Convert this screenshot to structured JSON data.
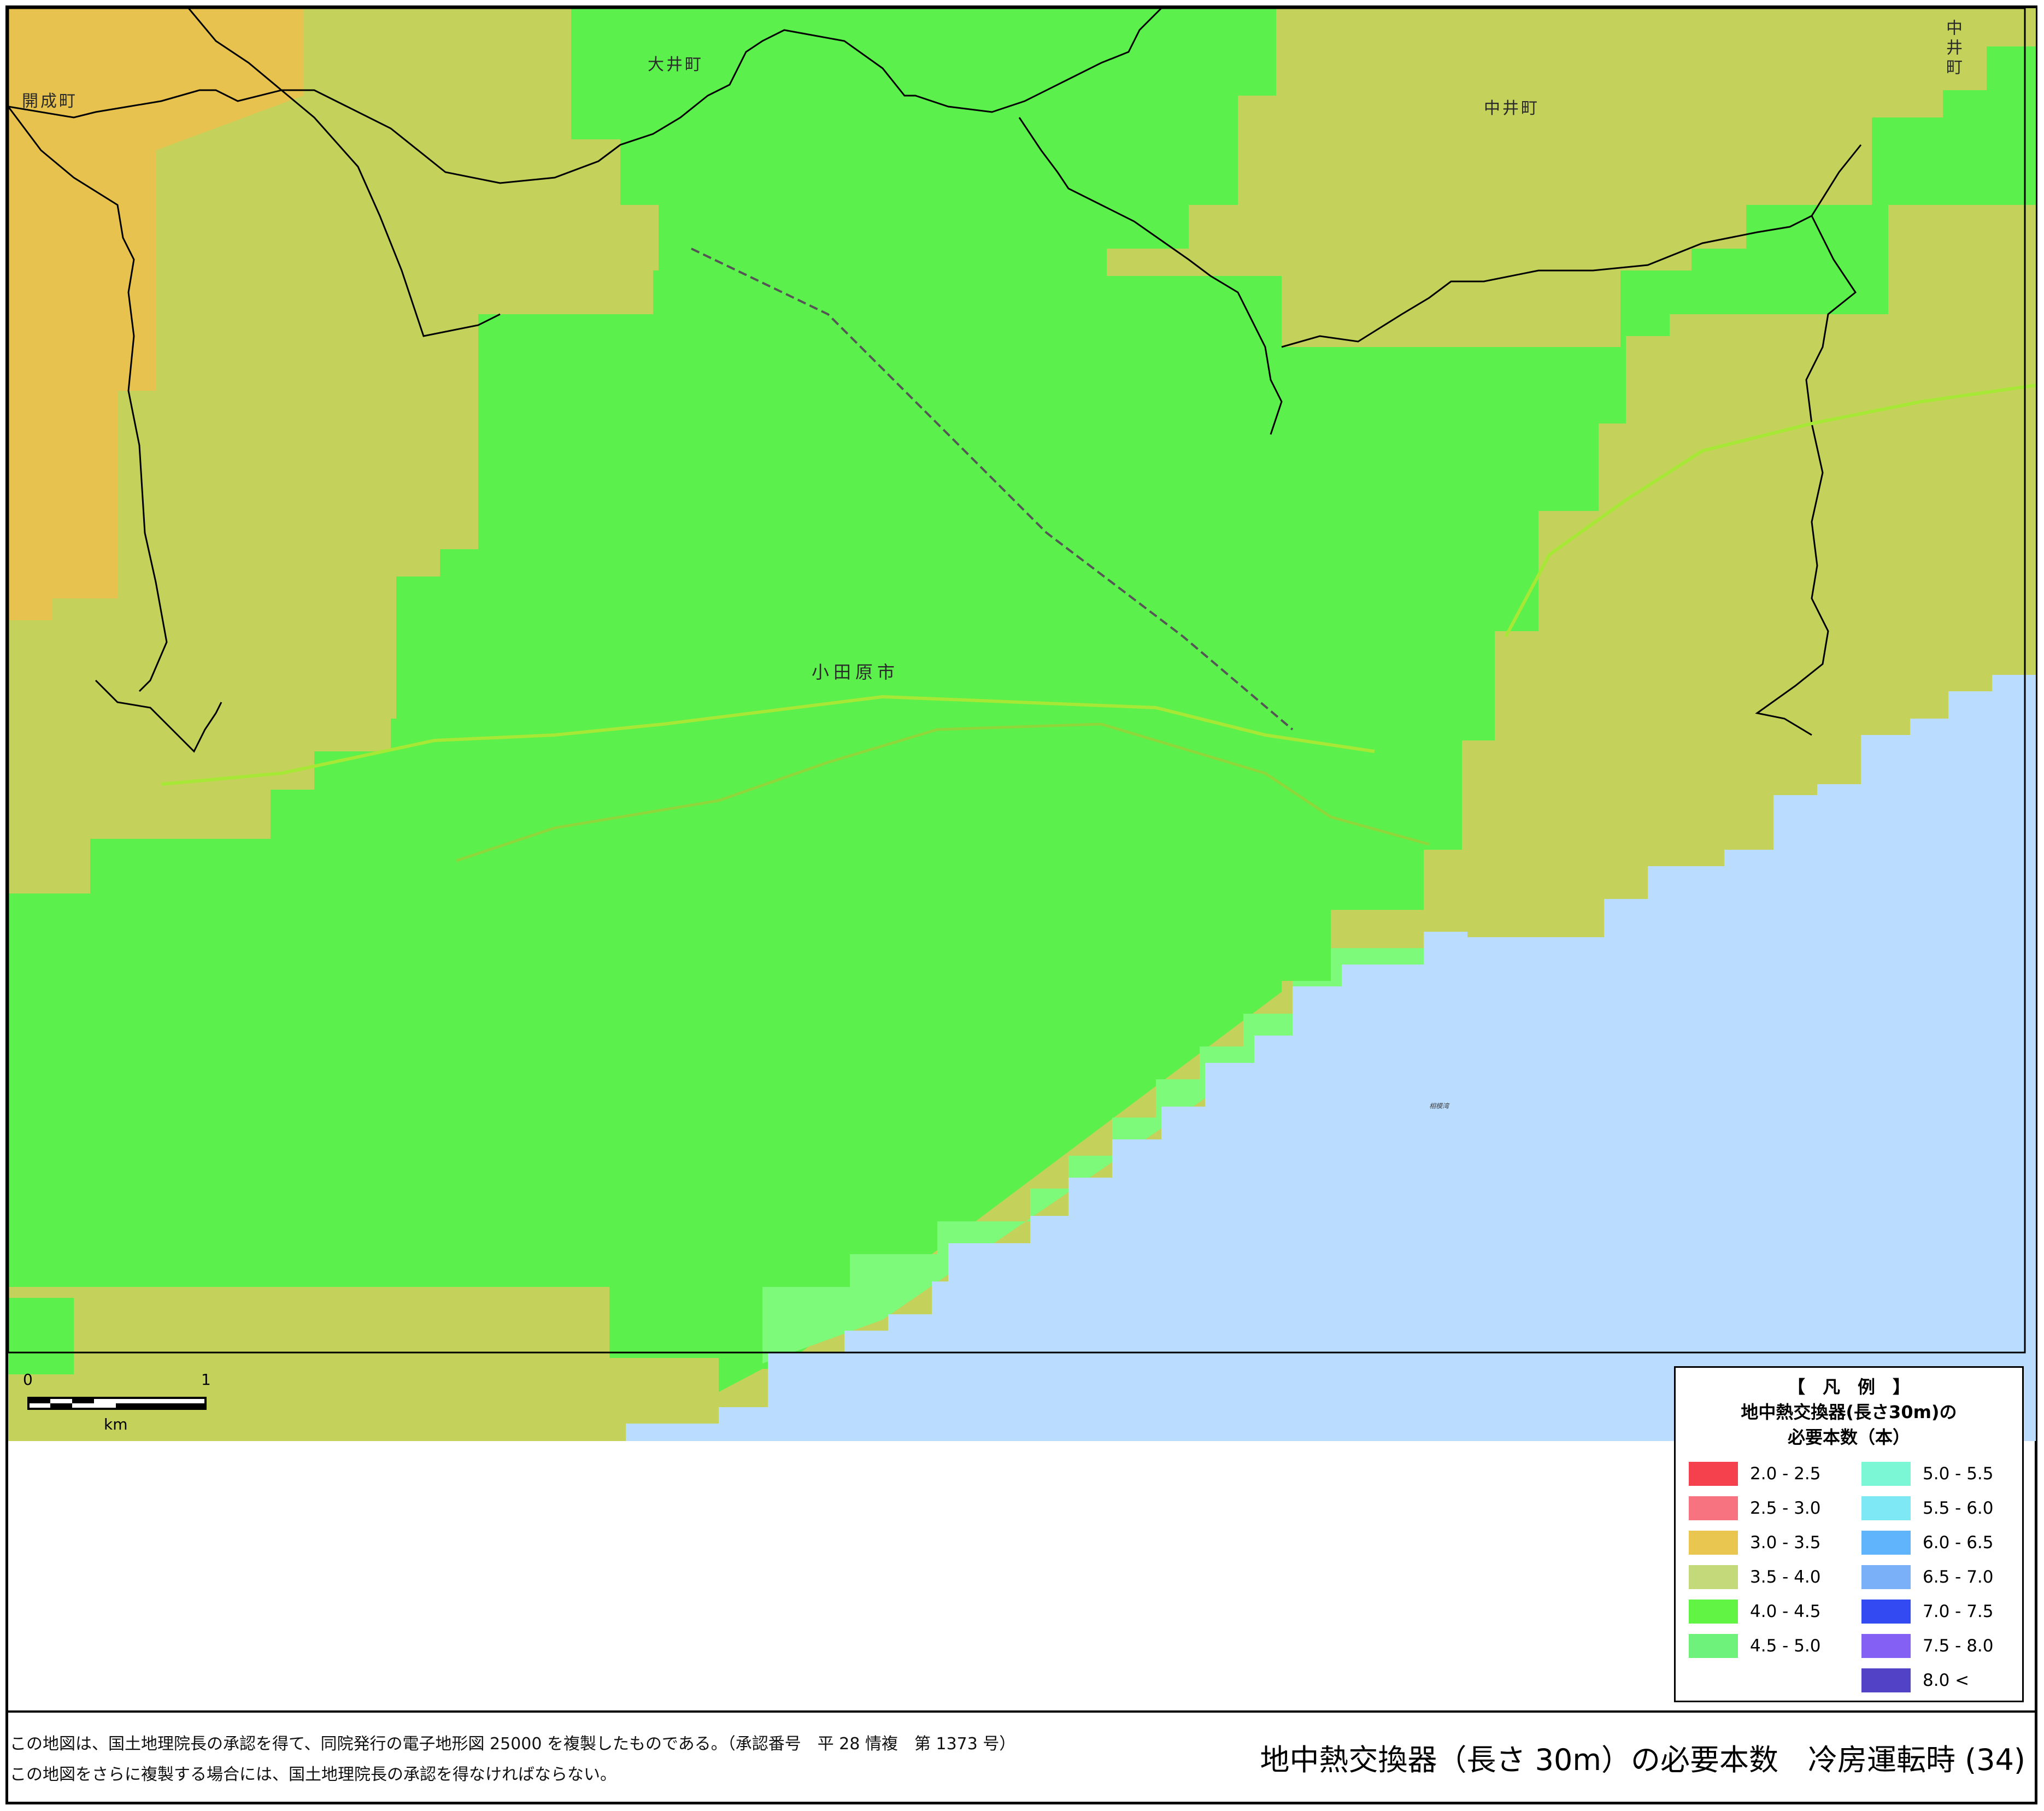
{
  "map": {
    "places": [
      {
        "name": "開成町",
        "key": "kaisei"
      },
      {
        "name": "大井町",
        "key": "oi"
      },
      {
        "name": "中井町",
        "key": "nakai"
      },
      {
        "name": "中井町",
        "key": "nakai-vertical"
      },
      {
        "name": "小田原市",
        "key": "odawara"
      },
      {
        "name": "相模湾",
        "key": "sagami-bay"
      }
    ],
    "colors": {
      "sea": "#b9dcff",
      "zone_3_0_3_5": "#e7c24e",
      "zone_3_5_4_0": "#c4d25b",
      "zone_4_0_4_5": "#5cf04c",
      "zone_4_5_5_0": "#7dfa7a",
      "boundary": "#000000"
    }
  },
  "scale": {
    "zero": "0",
    "one": "1",
    "unit": "km"
  },
  "legend": {
    "title": "【　凡　例　】",
    "subtitle1": "地中熱交換器(長さ30m)の",
    "subtitle2": "必要本数（本）",
    "items": [
      {
        "range": "2.0  -  2.5",
        "color": "#f5404e"
      },
      {
        "range": "2.5  -  3.0",
        "color": "#f87380"
      },
      {
        "range": "3.0  -  3.5",
        "color": "#e8c64f"
      },
      {
        "range": "3.5  -  4.0",
        "color": "#c4d97a"
      },
      {
        "range": "4.0  -  4.5",
        "color": "#62f444"
      },
      {
        "range": "4.5  -  5.0",
        "color": "#6ff27b"
      },
      {
        "range": "5.0  -  5.5",
        "color": "#7bf7d6"
      },
      {
        "range": "5.5  -  6.0",
        "color": "#7ee8f5"
      },
      {
        "range": "6.0  -  6.5",
        "color": "#5fb4fb"
      },
      {
        "range": "6.5  -  7.0",
        "color": "#79b0f7"
      },
      {
        "range": "7.0  -  7.5",
        "color": "#3349f2"
      },
      {
        "range": "7.5  -  8.0",
        "color": "#8461f4"
      },
      {
        "range": "8.0 <",
        "color": "#5242c6"
      }
    ]
  },
  "footer": {
    "note1": "この地図は、国土地理院長の承認を得て、同院発行の電子地形図 25000 を複製したものである。（承認番号　平 28 情複　第 1373 号）",
    "note2": "この地図をさらに複製する場合には、国土地理院長の承認を得なければならない。",
    "title": "地中熱交換器（長さ 30m）の必要本数　冷房運転時 (34)"
  }
}
